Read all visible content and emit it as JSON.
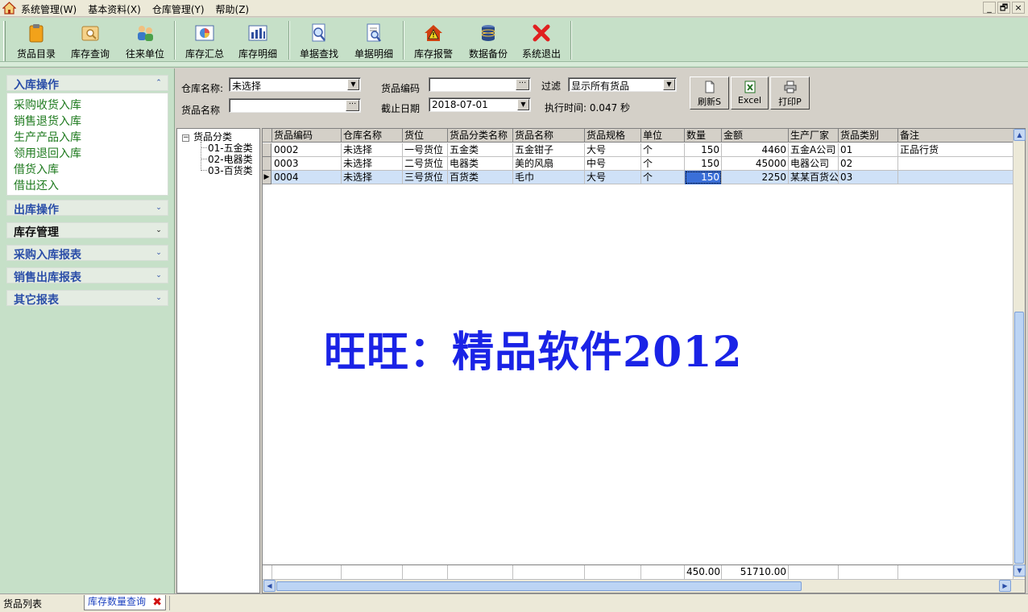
{
  "menubar": {
    "items": [
      "系统管理(W)",
      "基本资料(X)",
      "仓库管理(Y)",
      "帮助(Z)"
    ],
    "window_controls": [
      "_",
      "🗗",
      "×"
    ]
  },
  "toolbar": {
    "buttons": [
      {
        "label": "货品目录",
        "icon": "clipboard-icon"
      },
      {
        "label": "库存查询",
        "icon": "folder-search-icon"
      },
      {
        "label": "往来单位",
        "icon": "users-icon"
      },
      {
        "label": "库存汇总",
        "icon": "pie-chart-icon"
      },
      {
        "label": "库存明细",
        "icon": "bar-chart-icon"
      },
      {
        "label": "单据查找",
        "icon": "find-document-icon"
      },
      {
        "label": "单据明细",
        "icon": "document-detail-icon"
      },
      {
        "label": "库存报警",
        "icon": "warning-home-icon"
      },
      {
        "label": "数据备份",
        "icon": "database-icon"
      },
      {
        "label": "系统退出",
        "icon": "exit-x-icon"
      }
    ]
  },
  "leftnav": {
    "groups": [
      {
        "title": "入库操作",
        "expanded": true
      },
      {
        "title": "出库操作",
        "expanded": false
      },
      {
        "title": "库存管理",
        "expanded": false
      },
      {
        "title": "采购入库报表",
        "expanded": false
      },
      {
        "title": "销售出库报表",
        "expanded": false
      },
      {
        "title": "其它报表",
        "expanded": false
      }
    ],
    "items": [
      "采购收货入库",
      "销售退货入库",
      "生产产品入库",
      "领用退回入库",
      "借货入库",
      "借出还入"
    ]
  },
  "filters": {
    "warehouse_label": "仓库名称:",
    "warehouse_value": "未选择",
    "goods_name_label": "货品名称",
    "goods_name_value": "",
    "goods_code_label": "货品编码",
    "goods_code_value": "",
    "end_date_label": "截止日期",
    "end_date_value": "2018-07-01",
    "filter_label": "过滤",
    "filter_value": "显示所有货品",
    "exec_time_label": "执行时间: 0.047 秒"
  },
  "actions": {
    "refresh": "刷新S",
    "excel": "Excel",
    "print": "打印P"
  },
  "tree": {
    "root": "货品分类",
    "children": [
      "01-五金类",
      "02-电器类",
      "03-百货类"
    ]
  },
  "grid": {
    "columns": [
      "货品编码",
      "仓库名称",
      "货位",
      "货品分类名称",
      "货品名称",
      "货品规格",
      "单位",
      "数量",
      "金额",
      "生产厂家",
      "货品类别",
      "备注"
    ],
    "rows": [
      [
        "0002",
        "未选择",
        "一号货位",
        "五金类",
        "五金钳子",
        "大号",
        "个",
        "150",
        "4460",
        "五金A公司",
        "01",
        "正品行货"
      ],
      [
        "0003",
        "未选择",
        "二号货位",
        "电器类",
        "美的风扇",
        "中号",
        "个",
        "150",
        "45000",
        "电器公司",
        "02",
        ""
      ],
      [
        "0004",
        "未选择",
        "三号货位",
        "百货类",
        "毛巾",
        "大号",
        "个",
        "150",
        "2250",
        "某某百货公",
        "03",
        ""
      ]
    ],
    "selected_row": 2,
    "totals": {
      "quantity": "450.00",
      "amount": "51710.00"
    }
  },
  "watermark": "旺旺：精品软件2012",
  "statusbar": {
    "label": "货品列表",
    "active_tab": "库存数量查询"
  }
}
